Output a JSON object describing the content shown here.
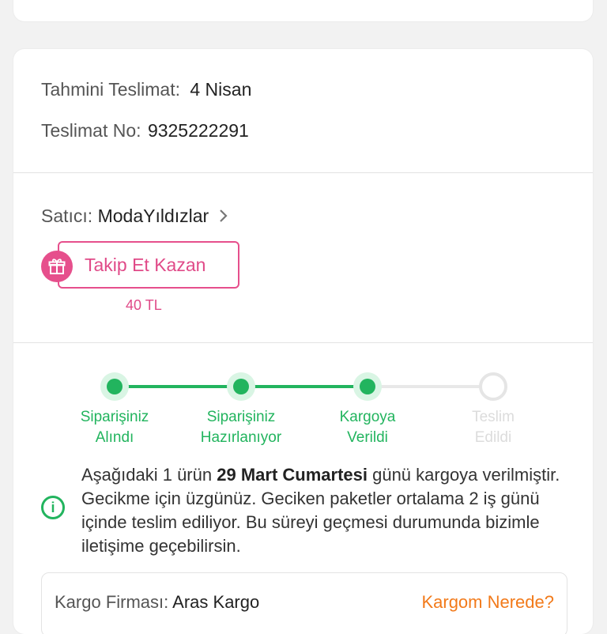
{
  "delivery": {
    "estimated_label": "Tahmini Teslimat:",
    "estimated_value": "4 Nisan",
    "number_label": "Teslimat No:",
    "number_value": "9325222291"
  },
  "seller": {
    "label": "Satıcı:",
    "name": "ModaYıldızlar",
    "follow_button": "Takip Et Kazan",
    "follow_reward": "40 TL"
  },
  "steps": [
    {
      "line1": "Siparişiniz",
      "line2": "Alındı",
      "status": "done"
    },
    {
      "line1": "Siparişiniz",
      "line2": "Hazırlanıyor",
      "status": "done"
    },
    {
      "line1": "Kargoya",
      "line2": "Verildi",
      "status": "done"
    },
    {
      "line1": "Teslim",
      "line2": "Edildi",
      "status": "todo"
    }
  ],
  "info": {
    "prefix": "Aşağıdaki 1 ürün ",
    "date": "29 Mart Cumartesi",
    "suffix": " günü kargoya verilmiştir. Gecikme için üzgünüz. Geciken paketler ortalama 2 iş günü içinde teslim ediliyor. Bu süreyi geçmesi durumunda bizimle iletişime geçebilirsin."
  },
  "cargo": {
    "label": "Kargo Firması:",
    "company": "Aras Kargo",
    "link": "Kargom Nerede?"
  },
  "colors": {
    "accent_green": "#22b45e",
    "accent_pink": "#e64f8c",
    "accent_orange": "#f27a1a"
  }
}
